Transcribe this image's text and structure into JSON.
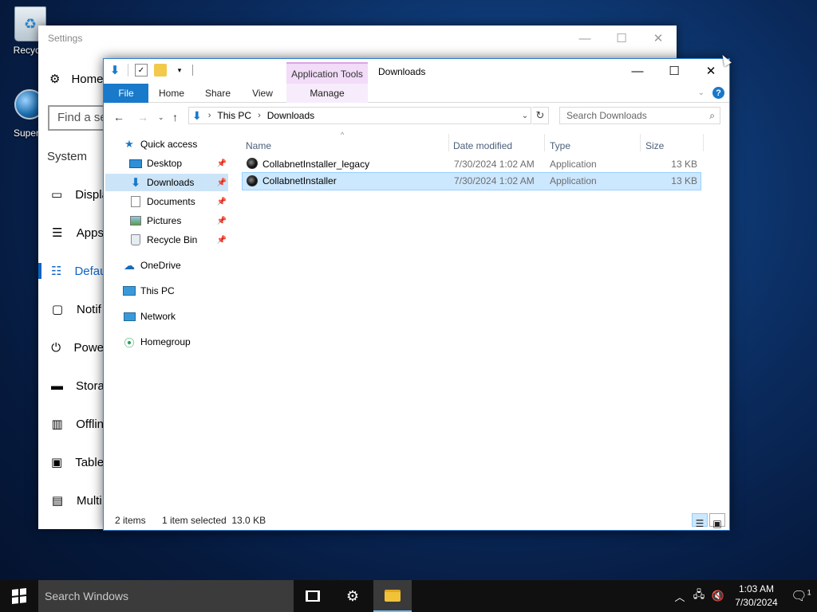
{
  "desktop": {
    "icons": [
      {
        "label": "Recycle"
      },
      {
        "label": "Superm"
      }
    ]
  },
  "settings": {
    "title": "Settings",
    "home": "Home",
    "search_placeholder": "Find a se",
    "section": "System",
    "nav": [
      {
        "label": "Displa",
        "icon": "display-icon"
      },
      {
        "label": "Apps",
        "icon": "apps-icon"
      },
      {
        "label": "Defau",
        "icon": "default-apps-icon",
        "active": true
      },
      {
        "label": "Notif",
        "icon": "notifications-icon"
      },
      {
        "label": "Powe",
        "icon": "power-icon"
      },
      {
        "label": "Stora",
        "icon": "storage-icon"
      },
      {
        "label": "Offlin",
        "icon": "offline-maps-icon"
      },
      {
        "label": "Table",
        "icon": "tablet-mode-icon"
      },
      {
        "label": "Multi",
        "icon": "multitasking-icon"
      }
    ]
  },
  "explorer": {
    "title": "Downloads",
    "context_tab": "Application Tools",
    "ribbon_tabs": [
      "File",
      "Home",
      "Share",
      "View",
      "Manage"
    ],
    "address": {
      "segments": [
        "This PC",
        "Downloads"
      ]
    },
    "search_placeholder": "Search Downloads",
    "nav_pane": [
      {
        "label": "Quick access",
        "icon": "star-icon",
        "level": 0
      },
      {
        "label": "Desktop",
        "icon": "desktop-icon",
        "level": 1,
        "pinned": true
      },
      {
        "label": "Downloads",
        "icon": "downloads-icon",
        "level": 1,
        "pinned": true,
        "selected": true
      },
      {
        "label": "Documents",
        "icon": "documents-icon",
        "level": 1,
        "pinned": true
      },
      {
        "label": "Pictures",
        "icon": "pictures-icon",
        "level": 1,
        "pinned": true
      },
      {
        "label": "Recycle Bin",
        "icon": "recycle-bin-icon",
        "level": 1,
        "pinned": true
      },
      {
        "label": "OneDrive",
        "icon": "onedrive-icon",
        "level": 0
      },
      {
        "label": "This PC",
        "icon": "this-pc-icon",
        "level": 0
      },
      {
        "label": "Network",
        "icon": "network-icon",
        "level": 0
      },
      {
        "label": "Homegroup",
        "icon": "homegroup-icon",
        "level": 0
      }
    ],
    "columns": [
      "Name",
      "Date modified",
      "Type",
      "Size"
    ],
    "files": [
      {
        "name": "CollabnetInstaller_legacy",
        "date": "7/30/2024 1:02 AM",
        "type": "Application",
        "size": "13 KB",
        "selected": false
      },
      {
        "name": "CollabnetInstaller",
        "date": "7/30/2024 1:02 AM",
        "type": "Application",
        "size": "13 KB",
        "selected": true
      }
    ],
    "status": {
      "items": "2 items",
      "selection": "1 item selected  13.0 KB"
    }
  },
  "taskbar": {
    "search_placeholder": "Search Windows",
    "time": "1:03 AM",
    "date": "7/30/2024",
    "notification_count": "1"
  }
}
